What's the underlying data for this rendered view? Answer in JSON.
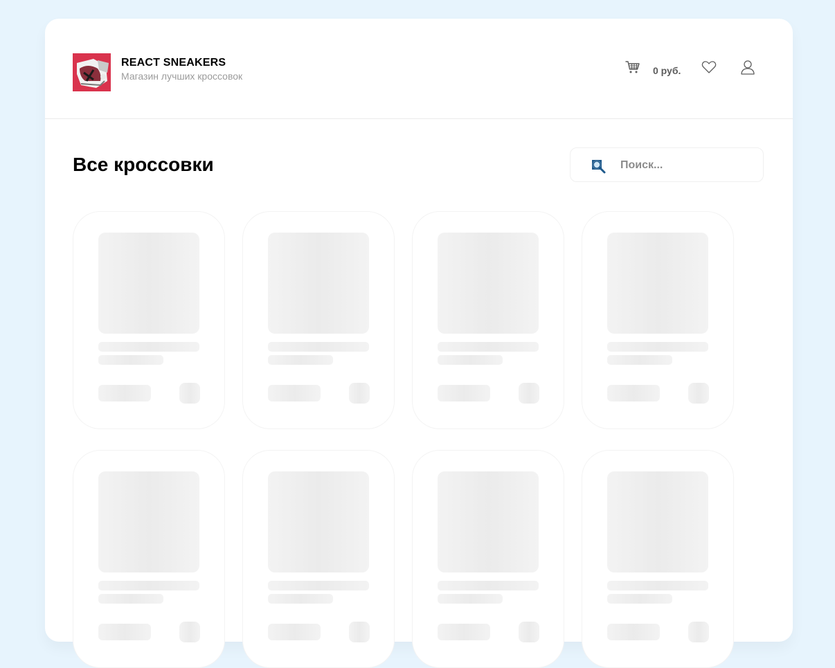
{
  "header": {
    "brand_title": "REACT SNEAKERS",
    "brand_subtitle": "Магазин лучших кроссовок",
    "cart_total": "0 руб.",
    "icons": [
      "cart-icon",
      "heart-icon",
      "user-icon"
    ]
  },
  "main": {
    "title": "Все кроссовки",
    "search": {
      "placeholder": "Поиск...",
      "value": ""
    }
  },
  "colors": {
    "background": "#e7f4fd",
    "logo": "#d9334d",
    "skeleton": "#f3f3f3",
    "search_icon": "#1f5a8c"
  },
  "grid": {
    "cards_visible": 8,
    "state": "loading"
  }
}
